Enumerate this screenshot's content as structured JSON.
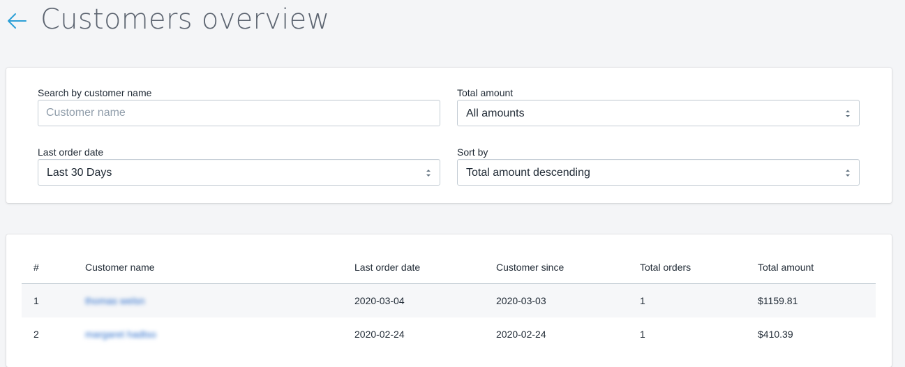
{
  "header": {
    "title": "Customers overview"
  },
  "filters": {
    "search": {
      "label": "Search by customer name",
      "placeholder": "Customer name",
      "value": ""
    },
    "total_amount": {
      "label": "Total amount",
      "selected": "All amounts"
    },
    "last_order_date": {
      "label": "Last order date",
      "selected": "Last 30 Days"
    },
    "sort_by": {
      "label": "Sort by",
      "selected": "Total amount descending"
    }
  },
  "table": {
    "columns": [
      "#",
      "Customer name",
      "Last order date",
      "Customer since",
      "Total orders",
      "Total amount"
    ],
    "rows": [
      {
        "index": "1",
        "name": "thomas welsn",
        "last_order": "2020-03-04",
        "since": "2020-03-03",
        "orders": "1",
        "amount": "$1159.81"
      },
      {
        "index": "2",
        "name": "margaret hadtso",
        "last_order": "2020-02-24",
        "since": "2020-02-24",
        "orders": "1",
        "amount": "$410.39"
      }
    ]
  },
  "colors": {
    "accent": "#2c9fd6",
    "link": "#2c6ecb",
    "background": "#f4f5f7"
  }
}
